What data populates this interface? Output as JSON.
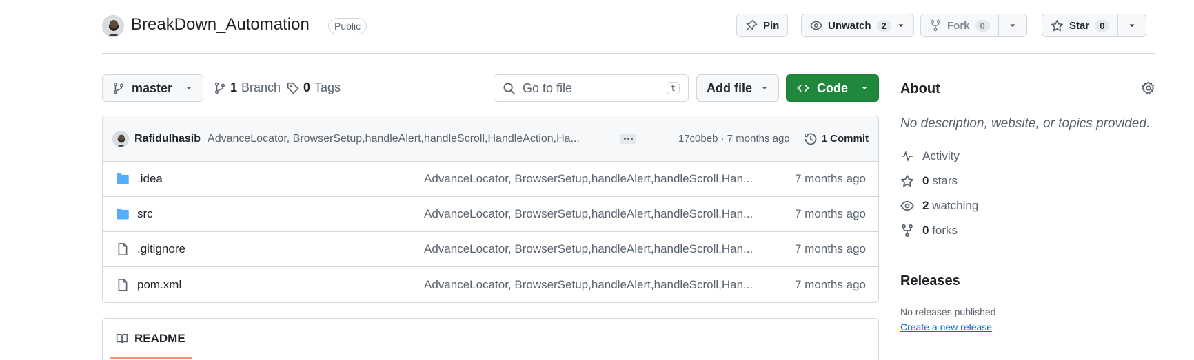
{
  "repo": {
    "name": "BreakDown_Automation",
    "visibility": "Public"
  },
  "header_actions": {
    "pin_label": "Pin",
    "unwatch_label": "Unwatch",
    "unwatch_count": "2",
    "fork_label": "Fork",
    "fork_count": "0",
    "star_label": "Star",
    "star_count": "0"
  },
  "toolbar": {
    "branch": "master",
    "branch_count": "1",
    "branch_label": "Branch",
    "tag_count": "0",
    "tag_label": "Tags",
    "search_placeholder": "Go to file",
    "search_shortcut": "t",
    "add_file_label": "Add file",
    "code_label": "Code"
  },
  "latest_commit": {
    "author": "Rafidulhasib",
    "message": "AdvanceLocator, BrowserSetup,handleAlert,handleScroll,HandleAction,Ha...",
    "sha_time": "17c0beb · 7 months ago",
    "commit_count_label": "1 Commit"
  },
  "files": [
    {
      "name": ".idea",
      "type": "folder",
      "message": "AdvanceLocator, BrowserSetup,handleAlert,handleScroll,Han...",
      "date": "7 months ago"
    },
    {
      "name": "src",
      "type": "folder",
      "message": "AdvanceLocator, BrowserSetup,handleAlert,handleScroll,Han...",
      "date": "7 months ago"
    },
    {
      "name": ".gitignore",
      "type": "file",
      "message": "AdvanceLocator, BrowserSetup,handleAlert,handleScroll,Han...",
      "date": "7 months ago"
    },
    {
      "name": "pom.xml",
      "type": "file",
      "message": "AdvanceLocator, BrowserSetup,handleAlert,handleScroll,Han...",
      "date": "7 months ago"
    }
  ],
  "readme": {
    "tab_label": "README"
  },
  "about": {
    "title": "About",
    "description": "No description, website, or topics provided.",
    "activity_label": "Activity",
    "stars_count": "0",
    "stars_label": "stars",
    "watching_count": "2",
    "watching_label": "watching",
    "forks_count": "0",
    "forks_label": "forks"
  },
  "releases": {
    "title": "Releases",
    "none_text": "No releases published",
    "create_link": "Create a new release"
  },
  "colors": {
    "accent_green": "#1f883d",
    "link_blue": "#0969da",
    "folder_blue": "#54aeff",
    "underline_orange": "#fd8c73"
  }
}
